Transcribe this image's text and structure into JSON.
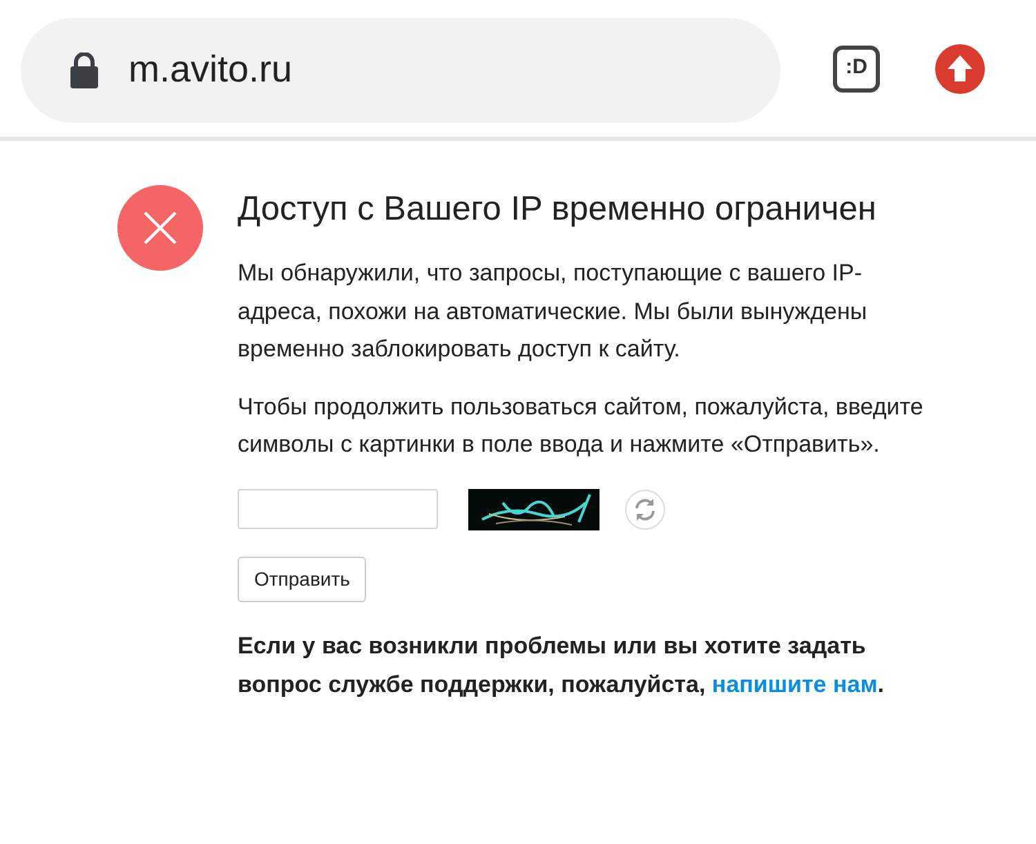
{
  "browser": {
    "url": "m.avito.ru",
    "extension_badge": ":D"
  },
  "page": {
    "title": "Доступ с Вашего IP временно ограничен",
    "paragraphs": [
      "Мы обнаружили, что запросы, поступающие с вашего IP-адреса, похожи на автоматические. Мы были вынуждены временно заблокировать доступ к сайту.",
      "Чтобы продолжить пользоваться сайтом, пожалуйста, введите символы с картинки в поле ввода и нажмите «Отправить»."
    ],
    "submit_button": "Отправить",
    "help_text": "Если у вас возникли проблемы или вы хотите задать вопрос службе поддержки, пожалуйста, ",
    "help_link": "напишите нам",
    "help_end": "."
  }
}
